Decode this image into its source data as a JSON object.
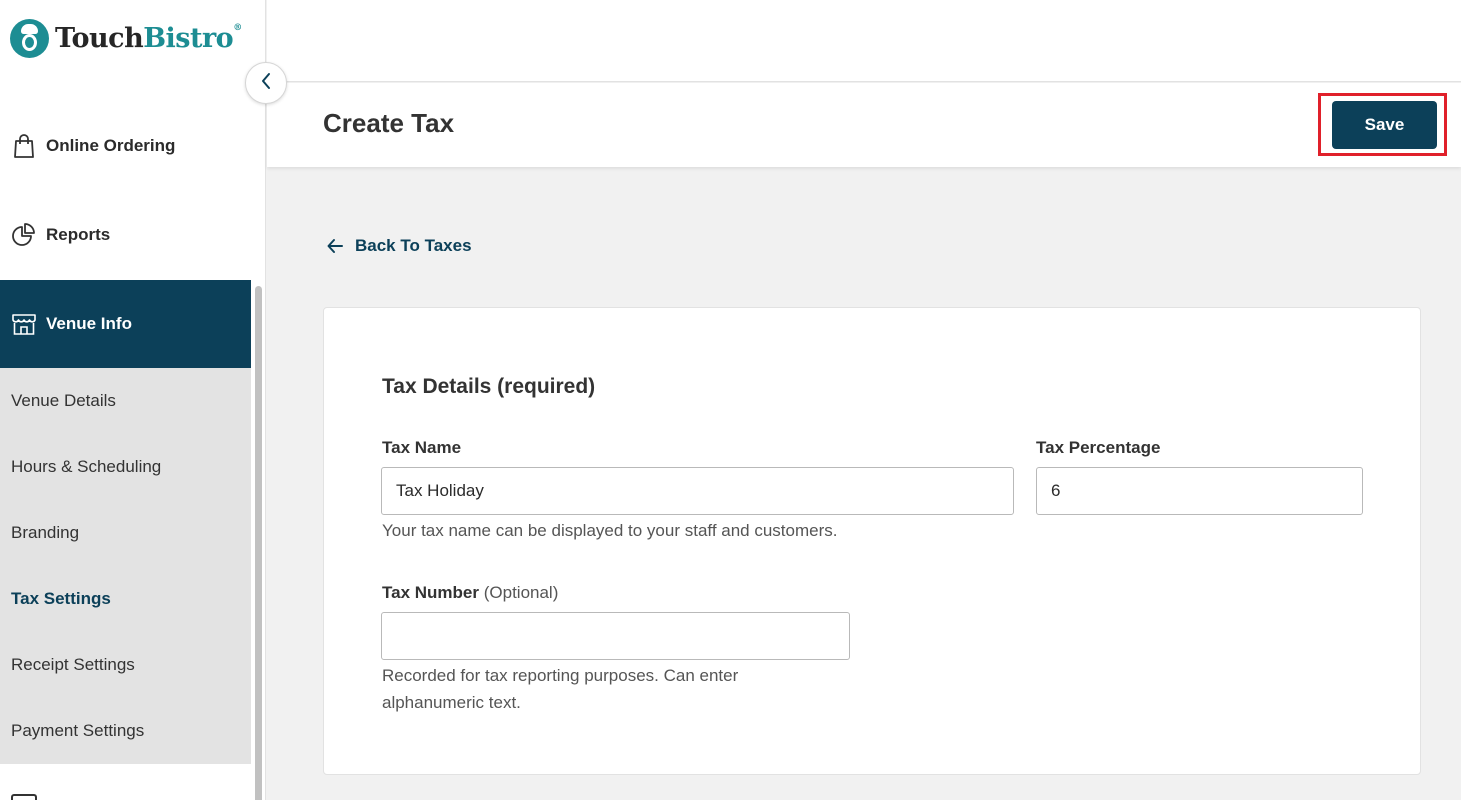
{
  "brand": {
    "name_part1": "Touch",
    "name_part2": "Bistro",
    "registered": "®",
    "teal": "#1d8d93",
    "navy": "#0c4059"
  },
  "sidebar": {
    "collapse_icon": "chevron-left-icon",
    "nav": [
      {
        "label": "Online Ordering",
        "icon": "shopping-bag-icon"
      },
      {
        "label": "Reports",
        "icon": "pie-chart-icon"
      },
      {
        "label": "Venue Info",
        "icon": "storefront-icon",
        "active": true
      }
    ],
    "subnav": [
      {
        "label": "Venue Details"
      },
      {
        "label": "Hours & Scheduling"
      },
      {
        "label": "Branding"
      },
      {
        "label": "Tax Settings",
        "active": true
      },
      {
        "label": "Receipt Settings"
      },
      {
        "label": "Payment Settings"
      }
    ]
  },
  "header": {
    "title": "Create Tax",
    "save_label": "Save",
    "highlight_color": "#e0202a"
  },
  "back_link": {
    "label": "Back To Taxes",
    "icon": "arrow-left-icon"
  },
  "form": {
    "section_title": "Tax Details (required)",
    "tax_name": {
      "label": "Tax Name",
      "value": "Tax Holiday",
      "help": "Your tax name can be displayed to your staff and customers."
    },
    "tax_percentage": {
      "label": "Tax Percentage",
      "value": "6"
    },
    "tax_number": {
      "label": "Tax Number",
      "optional": "(Optional)",
      "value": "",
      "help_line1": "Recorded for tax reporting purposes. Can enter",
      "help_line2": "alphanumeric text."
    }
  }
}
